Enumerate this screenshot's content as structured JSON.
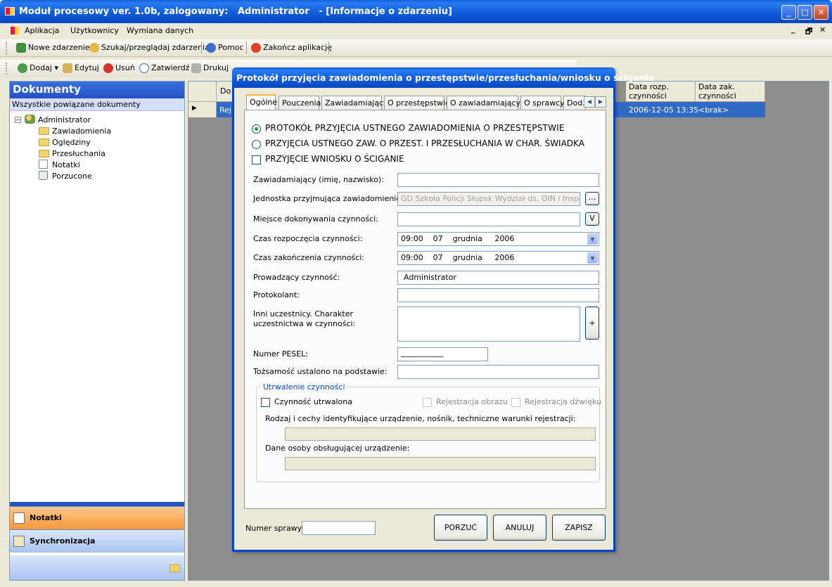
{
  "window": {
    "title": "Moduł procesowy ver. 1.0b, zalogowany:   Administrator   - [Informacje o zdarzeniu]"
  },
  "menu": {
    "items": [
      "Aplikacja",
      "Użytkownicy",
      "Wymiana danych"
    ]
  },
  "toolbar1": {
    "new_event": "Nowe zdarzenie",
    "search": "Szukaj/przeglądaj zdarzenia",
    "help": "Pomoc",
    "exit": "Zakończ aplikację"
  },
  "toolbar2": {
    "add": "Dodaj",
    "edit": "Edytuj",
    "delete": "Usuń",
    "approve": "Zatwierdź",
    "print": "Drukuj"
  },
  "left": {
    "title": "Dokumenty",
    "subtitle": "Wszystkie powiązane dokumenty",
    "tree": {
      "root": "Administrator",
      "children": [
        "Zawiadomienia",
        "Oględziny",
        "Przesłuchania",
        "Notatki",
        "Porzucone"
      ]
    },
    "nav": {
      "notes": "Notatki",
      "sync": "Synchronizacja"
    }
  },
  "grid": {
    "col_doc": "Do",
    "col_start": "Data rozp. czynności",
    "col_end": "Data zak. czynności",
    "row": {
      "doc": "Rej",
      "start": "2006-12-05 13:35",
      "end": "<brak>"
    }
  },
  "dialog": {
    "title": "Protokół przyjęcia zawiadomienia o przestępstwie/przesłuchania/wniosku o ściganie",
    "tabs": [
      "Ogólne",
      "Pouczenia",
      "Zawiadamiający",
      "O przestępstwie",
      "O zawiadamiającym",
      "O sprawcy",
      "Dod."
    ],
    "options": {
      "radio1": "PROTOKÓŁ PRZYJĘCIA USTNEGO ZAWIADOMIENIA O PRZESTĘPSTWIE",
      "radio2": "PRZYJĘCIA USTNEGO ZAW. O PRZEST. I PRZESŁUCHANIA W CHAR. ŚWIADKA",
      "check": "PRZYJĘCIE WNIOSKU O ŚCIGANIE"
    },
    "fields": {
      "informant_label": "Zawiadamiający (imię, nazwisko):",
      "unit_label": "Jednostka przyjmująca zawiadomienie:",
      "unit_value": "GD Szkoła Policji Słupsk Wydział ds. OIN i Inspekcji",
      "place_label": "Miejsce dokonywania czynności:",
      "start_label": "Czas rozpoczęcia czynności:",
      "start_value": "09:00    07    grudnia     2006",
      "end_label": "Czas zakończenia czynności:",
      "end_value": "09:00    07    grudnia     2006",
      "leader_label": "Prowadzący czynność:",
      "leader_value": "Administrator",
      "recorder_label": "Protokolant:",
      "others_label": "Inni uczestnicy. Charakter uczestnictwa w czynności:",
      "pesel_label": "Numer PESEL:",
      "pesel_value": "___________",
      "identity_label": "Tożsamość ustalono na podstawie:"
    },
    "browse_btn": "...",
    "v_btn": "V",
    "plus_btn": "+",
    "recording": {
      "legend": "Utrwalenie czynności",
      "recorded": "Czynność utrwalona",
      "image": "Rejestracja obrazu",
      "sound": "Rejestracja dźwięku",
      "device_label": "Rodzaj i cechy identyfikujące urządzenie, nośnik, techniczne warunki rejestracji:",
      "operator_label": "Dane osoby obsługującej urządzenie:"
    },
    "case_label": "Numer sprawy:",
    "buttons": {
      "abandon": "PORZUĆ",
      "cancel": "ANULUJ",
      "save": "ZAPISZ"
    }
  }
}
